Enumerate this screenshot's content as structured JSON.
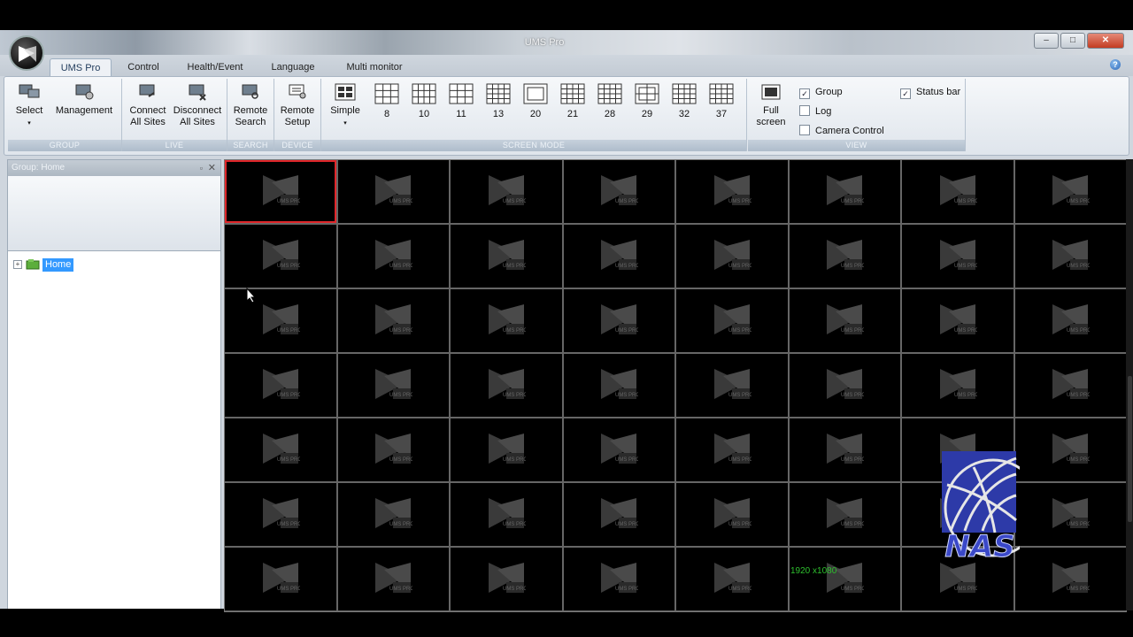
{
  "window": {
    "title": "UMS Pro",
    "min": "–",
    "max": "□",
    "close": "✕"
  },
  "menu": {
    "tabs": [
      "UMS Pro",
      "Control",
      "Health/Event",
      "Language",
      "Multi monitor"
    ],
    "help": "?"
  },
  "ribbon": {
    "group": {
      "label": "GROUP",
      "select": "Select",
      "management": "Management"
    },
    "live": {
      "label": "LIVE",
      "connect_l1": "Connect",
      "connect_l2": "All Sites",
      "disconnect_l1": "Disconnect",
      "disconnect_l2": "All Sites"
    },
    "search": {
      "label": "SEARCH",
      "remote_l1": "Remote",
      "remote_l2": "Search"
    },
    "device": {
      "label": "DEVICE",
      "setup_l1": "Remote",
      "setup_l2": "Setup"
    },
    "screen_mode": {
      "label": "SCREEN MODE",
      "simple": "Simple",
      "layouts": [
        "8",
        "10",
        "11",
        "13",
        "20",
        "21",
        "28",
        "29",
        "32",
        "37"
      ]
    },
    "view": {
      "label": "VIEW",
      "full_l1": "Full",
      "full_l2": "screen",
      "group": "Group",
      "log": "Log",
      "camera_control": "Camera Control",
      "status_bar": "Status bar",
      "group_checked": true,
      "log_checked": false,
      "camera_control_checked": false,
      "status_bar_checked": true
    }
  },
  "sidepanel": {
    "title": "Group: Home",
    "pin": "▫",
    "close": "✕",
    "tree_root": "Home",
    "expander": "+"
  },
  "video_grid": {
    "rows": 7,
    "cols": 8,
    "selected_cell": 0,
    "cell_logo_text": "UMS PRO"
  },
  "overlay": {
    "resolution_text": "1920 x1080",
    "watermark_text": "NAS"
  },
  "colors": {
    "selected_outline": "#e0262a",
    "tree_highlight": "#3399ff",
    "resolution_text": "#2ec02e"
  }
}
